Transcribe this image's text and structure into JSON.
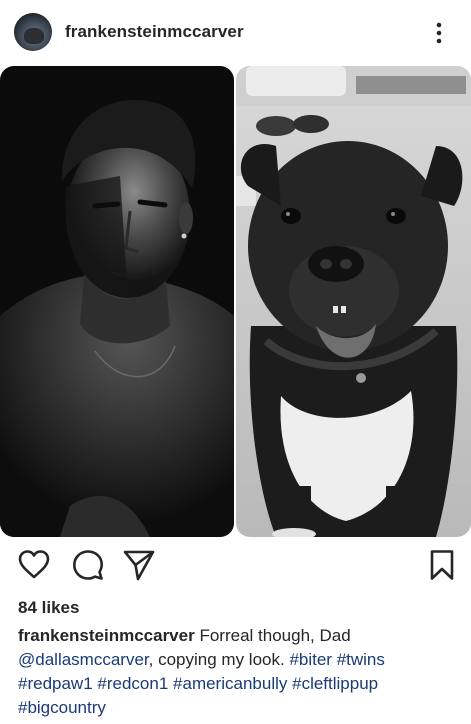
{
  "post": {
    "username": "frankensteinmccarver",
    "more_icon": "more-vertical-icon"
  },
  "actions": {
    "like_icon": "heart-icon",
    "comment_icon": "comment-icon",
    "share_icon": "send-icon",
    "save_icon": "bookmark-icon"
  },
  "likes_label": "84 likes",
  "caption": {
    "username": "frankensteinmccarver",
    "text_1": "Forreal though, Dad",
    "mention": "@dallasmccarver",
    "text_2": ", copying my look.",
    "hashtags": [
      "#biter",
      "#twins",
      "#redpaw1",
      "#redcon1",
      "#americanbully",
      "#cleftlippup",
      "#bigcountry"
    ]
  },
  "colors": {
    "text": "#262626",
    "link": "#1a3a78",
    "background": "#ffffff"
  }
}
